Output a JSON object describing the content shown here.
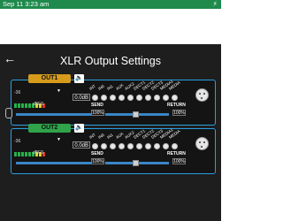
{
  "status": {
    "time": "Sep 11 3:23 am",
    "icon": "charging-bolt-icon"
  },
  "header": {
    "title": "XLR Output Settings",
    "back_icon": "back-arrow-icon"
  },
  "channels": [
    "INT",
    "IN0",
    "IN1",
    "AUX",
    "AUX2",
    "DECT1",
    "DECT2",
    "DECT3",
    "MEDIA1",
    "MEDIA"
  ],
  "outputs": [
    {
      "name": "OUT1",
      "gain": "0.0dB",
      "db_label": "dBFS",
      "meter_min": "-36",
      "send_label": "SEND",
      "return_label": "RETURN",
      "send_pct": "100%",
      "return_pct": "100%",
      "send_value": 100,
      "return_value": 100,
      "color": "#d69b1b"
    },
    {
      "name": "OUT2",
      "gain": "0.0dB",
      "db_label": "dBFS",
      "meter_min": "-36",
      "send_label": "SEND",
      "return_label": "RETURN",
      "send_pct": "100%",
      "return_pct": "100%",
      "send_value": 100,
      "return_value": 100,
      "color": "#2fa24a"
    }
  ],
  "icons": {
    "speaker": "speaker-icon",
    "xlr": "xlr-connector-icon",
    "link": "link-icon"
  },
  "colors": {
    "status_green": "#1f8a4c",
    "accent_blue": "#2a9fe0"
  }
}
